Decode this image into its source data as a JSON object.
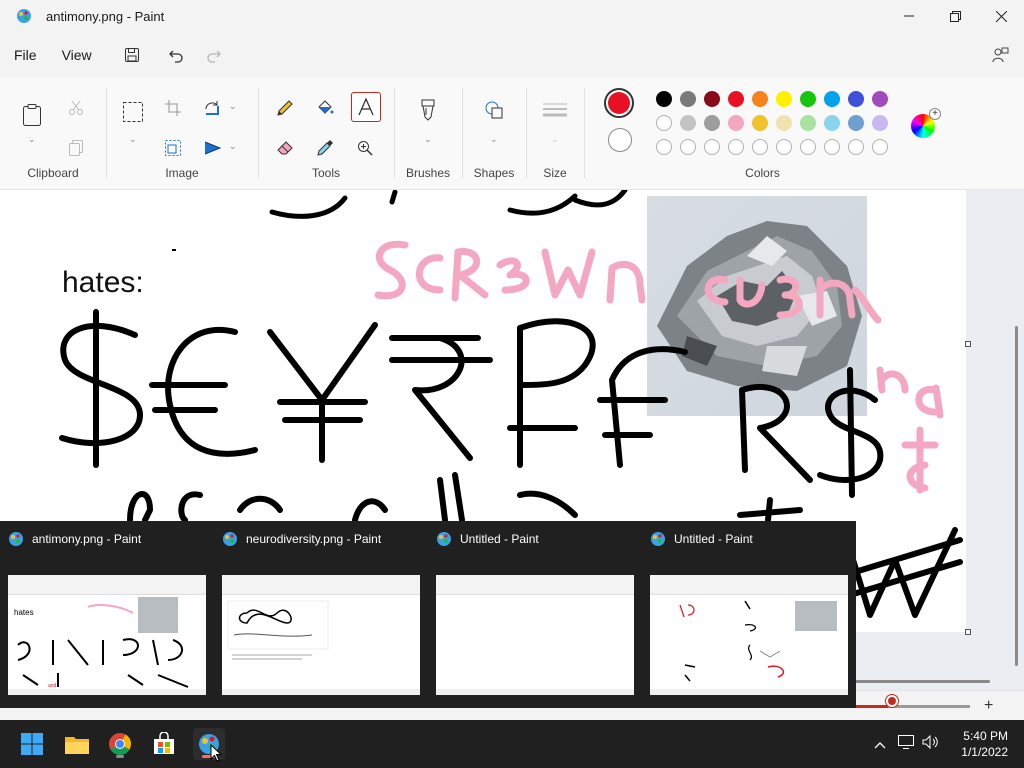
{
  "window": {
    "title": "antimony.png - Paint",
    "controls": {
      "minimize_icon": "minimize-icon",
      "maximize_icon": "restore-icon",
      "close_icon": "close-icon"
    }
  },
  "menubar": {
    "file": "File",
    "view": "View",
    "icons": [
      "save-icon",
      "undo-icon",
      "redo-icon",
      "share-icon"
    ]
  },
  "ribbon": {
    "groups": {
      "clipboard": "Clipboard",
      "image": "Image",
      "tools": "Tools",
      "brushes": "Brushes",
      "shapes": "Shapes",
      "size": "Size",
      "colors": "Colors"
    },
    "active_tool": "text-icon",
    "primary_color": "#e81123",
    "secondary_color": "#ffffff",
    "palette_row1": [
      "#000000",
      "#7a7a7a",
      "#8b0a1a",
      "#e81123",
      "#f7821b",
      "#fff100",
      "#16c60c",
      "#00a2ed",
      "#4050d8",
      "#a04bbd"
    ],
    "palette_row2": [
      "#ffffff",
      "#c3c3c3",
      "#9e9e9e",
      "#f4a7c0",
      "#f2c12e",
      "#efe4b0",
      "#a8e2a0",
      "#8ad4f0",
      "#6fa0d0",
      "#c8b7f0"
    ],
    "palette_row3_count": 10
  },
  "canvas": {
    "text_hates": "hates:",
    "image_name": "antimony-ore-photo",
    "scrawl_pink": "Screwn cu3n",
    "scrawl_black": "$€¥₹₽₣R$"
  },
  "switcher": {
    "items": [
      {
        "title": "antimony.png - Paint"
      },
      {
        "title": "neurodiversity.png - Paint"
      },
      {
        "title": "Untitled - Paint"
      },
      {
        "title": "Untitled - Paint"
      }
    ]
  },
  "taskbar": {
    "apps": [
      "start-icon",
      "file-explorer-icon",
      "chrome-icon",
      "store-icon",
      "paint-icon"
    ],
    "active_app": "paint-icon",
    "time": "5:40 PM",
    "date": "1/1/2022"
  }
}
